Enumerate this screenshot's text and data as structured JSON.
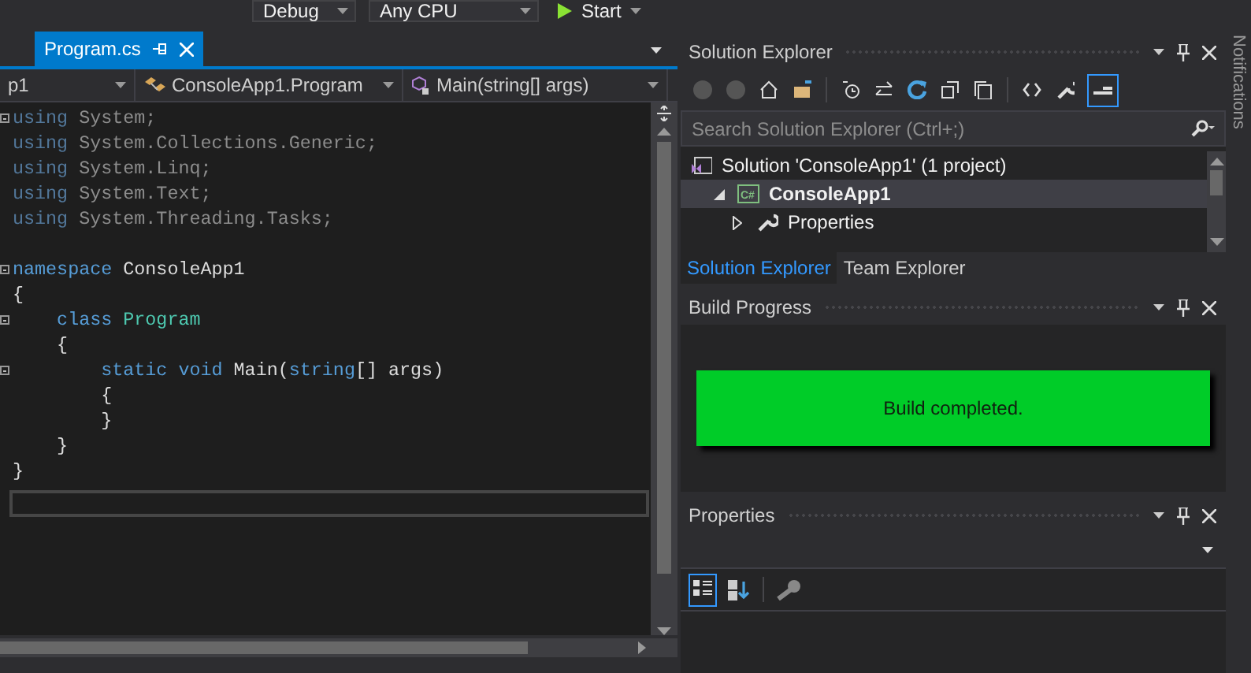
{
  "toolbar": {
    "configuration": "Debug",
    "platform": "Any CPU",
    "start": "Start"
  },
  "editor": {
    "tabs": [
      {
        "title": "Program.cs",
        "selected": true
      }
    ],
    "nav": [
      "p1",
      "ConsoleApp1.Program",
      "Main(string[] args)"
    ],
    "lines": [
      {
        "collapsible": true,
        "tokens": [
          {
            "kind": "unused-keyword",
            "text": "using"
          },
          {
            "kind": "unused",
            "text": " System;"
          }
        ]
      },
      {
        "collapsible": false,
        "tokens": [
          {
            "kind": "unused-keyword",
            "text": "using"
          },
          {
            "kind": "unused",
            "text": " System.Collections.Generic;"
          }
        ]
      },
      {
        "collapsible": false,
        "tokens": [
          {
            "kind": "unused-keyword",
            "text": "using"
          },
          {
            "kind": "unused",
            "text": " System.Linq;"
          }
        ]
      },
      {
        "collapsible": false,
        "tokens": [
          {
            "kind": "unused-keyword",
            "text": "using"
          },
          {
            "kind": "unused",
            "text": " System.Text;"
          }
        ]
      },
      {
        "collapsible": false,
        "tokens": [
          {
            "kind": "unused-keyword",
            "text": "using"
          },
          {
            "kind": "unused",
            "text": " System.Threading.Tasks;"
          }
        ]
      },
      {
        "collapsible": true,
        "blank_line_before": true,
        "tokens": [
          {
            "kind": "keyword",
            "text": "namespace"
          },
          {
            "kind": "plain",
            "text": " ConsoleApp1"
          }
        ]
      },
      {
        "collapsible": false,
        "tokens": [
          {
            "kind": "plain",
            "text": "{"
          }
        ]
      },
      {
        "collapsible": true,
        "tokens": [
          {
            "kind": "keyword",
            "text": "    class"
          },
          {
            "kind": "type",
            "text": " Program"
          }
        ]
      },
      {
        "collapsible": false,
        "tokens": [
          {
            "kind": "plain",
            "text": "    {"
          }
        ]
      },
      {
        "collapsible": true,
        "tokens": [
          {
            "kind": "keyword",
            "text": "        static"
          },
          {
            "kind": "keyword",
            "text": " void"
          },
          {
            "kind": "plain",
            "text": " Main("
          },
          {
            "kind": "keyword",
            "text": "string"
          },
          {
            "kind": "plain",
            "text": "[] args)"
          }
        ]
      },
      {
        "collapsible": false,
        "tokens": [
          {
            "kind": "plain",
            "text": "        {"
          }
        ]
      },
      {
        "collapsible": false,
        "tokens": [
          {
            "kind": "plain",
            "text": "        }"
          }
        ]
      },
      {
        "collapsible": false,
        "tokens": [
          {
            "kind": "plain",
            "text": "    }"
          }
        ]
      },
      {
        "collapsible": false,
        "tokens": [
          {
            "kind": "plain",
            "text": "}"
          }
        ]
      }
    ]
  },
  "solution_explorer": {
    "title": "Solution Explorer",
    "search": {
      "placeholder": "Search Solution Explorer (Ctrl+;)"
    },
    "tree": [
      {
        "label": "Solution 'ConsoleApp1' (1 project)",
        "kind": "solution",
        "selected": false,
        "children": [
          {
            "label": "ConsoleApp1",
            "kind": "project",
            "icon_text": "C#",
            "selected": true,
            "expanded": true,
            "children": [
              {
                "label": "Properties",
                "kind": "properties",
                "selected": false,
                "expanded": false
              }
            ]
          }
        ]
      }
    ],
    "tabs": [
      {
        "label": "Solution Explorer",
        "selected": true
      },
      {
        "label": "Team Explorer",
        "selected": false
      }
    ]
  },
  "build_progress": {
    "title": "Build Progress",
    "message": "Build completed."
  },
  "properties": {
    "title": "Properties"
  },
  "notifications": {
    "label": "Notifications"
  }
}
